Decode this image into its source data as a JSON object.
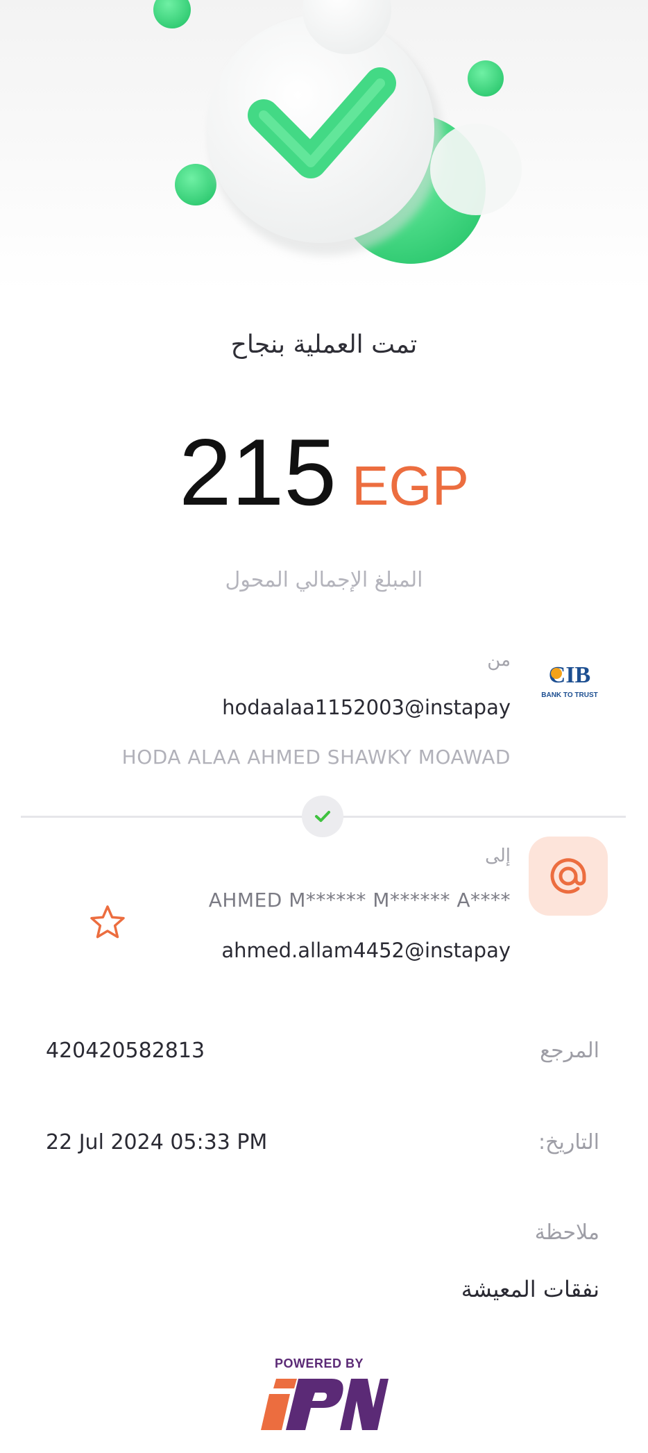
{
  "header": {
    "status_title": "تمت العملية بنجاح"
  },
  "amount": {
    "value": "215",
    "currency": "EGP",
    "caption": "المبلغ الإجمالي المحول"
  },
  "sender": {
    "label": "من",
    "handle": "hodaalaa1152003@instapay",
    "name": "HODA ALAA AHMED SHAWKY MOAWAD",
    "bank_logo": "CIB",
    "bank_tagline": "BANK TO TRUST"
  },
  "receiver": {
    "label": "إلى",
    "name": "AHMED M****** M****** A****",
    "handle": "ahmed.allam4452@instapay",
    "icon": "at-sign-icon",
    "favorite_icon": "star-outline-icon"
  },
  "details": {
    "reference_label": "المرجع",
    "reference_value": "420420582813",
    "date_label": "التاريخ:",
    "date_value": "22 Jul 2024 05:33 PM",
    "note_label": "ملاحظة",
    "note_value": "نفقات المعيشة"
  },
  "footer": {
    "powered_by": "POWERED BY",
    "brand": "IPN"
  },
  "colors": {
    "success_green": "#3fd17e",
    "accent_orange": "#ec6d3f",
    "badge_bg": "#fde4da",
    "brand_purple": "#5b2a76",
    "bank_blue": "#1d4f91"
  }
}
